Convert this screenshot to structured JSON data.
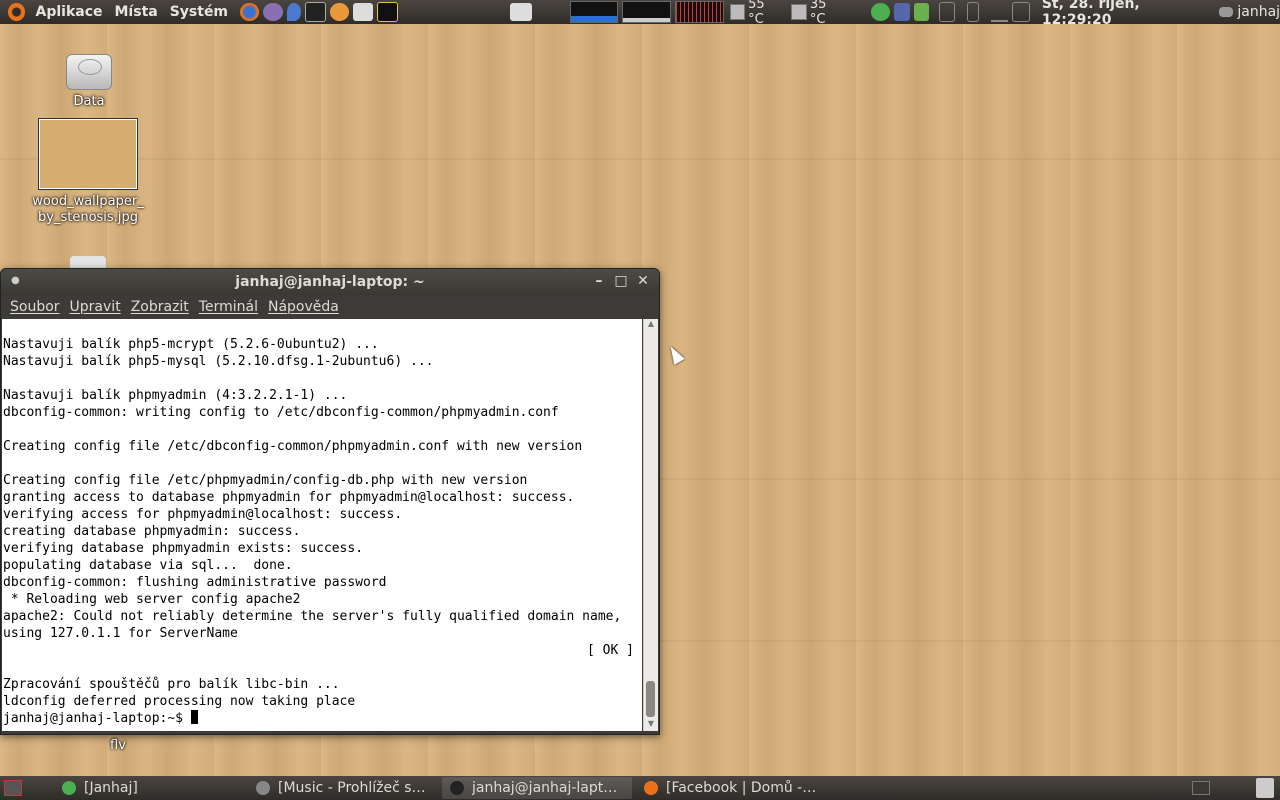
{
  "top_panel": {
    "menus": [
      "Aplikace",
      "Místa",
      "Systém"
    ],
    "temp1": "55 °C",
    "temp2": "35 °C",
    "clock": "St, 28. říjen, 12:29:20",
    "user": "janhaj"
  },
  "desktop": {
    "icons": [
      {
        "label": "Data"
      },
      {
        "label": "wood_wallpaper_\nby_stenosis.jpg"
      },
      {
        "label": "flv"
      }
    ]
  },
  "terminal": {
    "title": "janhaj@janhaj-laptop: ~",
    "menus": [
      "Soubor",
      "Upravit",
      "Zobrazit",
      "Terminál",
      "Nápověda"
    ],
    "lines": [
      "Nastavuji balík php5-mcrypt (5.2.6-0ubuntu2) ...",
      "Nastavuji balík php5-mysql (5.2.10.dfsg.1-2ubuntu6) ...",
      "",
      "Nastavuji balík phpmyadmin (4:3.2.2.1-1) ...",
      "dbconfig-common: writing config to /etc/dbconfig-common/phpmyadmin.conf",
      "",
      "Creating config file /etc/dbconfig-common/phpmyadmin.conf with new version",
      "",
      "Creating config file /etc/phpmyadmin/config-db.php with new version",
      "granting access to database phpmyadmin for phpmyadmin@localhost: success.",
      "verifying access for phpmyadmin@localhost: success.",
      "creating database phpmyadmin: success.",
      "verifying database phpmyadmin exists: success.",
      "populating database via sql...  done.",
      "dbconfig-common: flushing administrative password",
      " * Reloading web server config apache2",
      "apache2: Could not reliably determine the server's fully qualified domain name,",
      "using 127.0.1.1 for ServerName"
    ],
    "ok_status": "[ OK ]",
    "lines_after": [
      "",
      "Zpracování spouštěčů pro balík libc-bin ...",
      "ldconfig deferred processing now taking place"
    ],
    "prompt": "janhaj@janhaj-laptop:~$ "
  },
  "taskbar": {
    "tasks": [
      {
        "label": "[Janhaj]",
        "color": "#4caf50"
      },
      {
        "label": "[Music - Prohlížeč so...",
        "color": "#888888"
      },
      {
        "label": "janhaj@janhaj-laptop...",
        "color": "#222222"
      },
      {
        "label": "[Facebook | Domů - ...",
        "color": "#e8731a"
      }
    ]
  }
}
